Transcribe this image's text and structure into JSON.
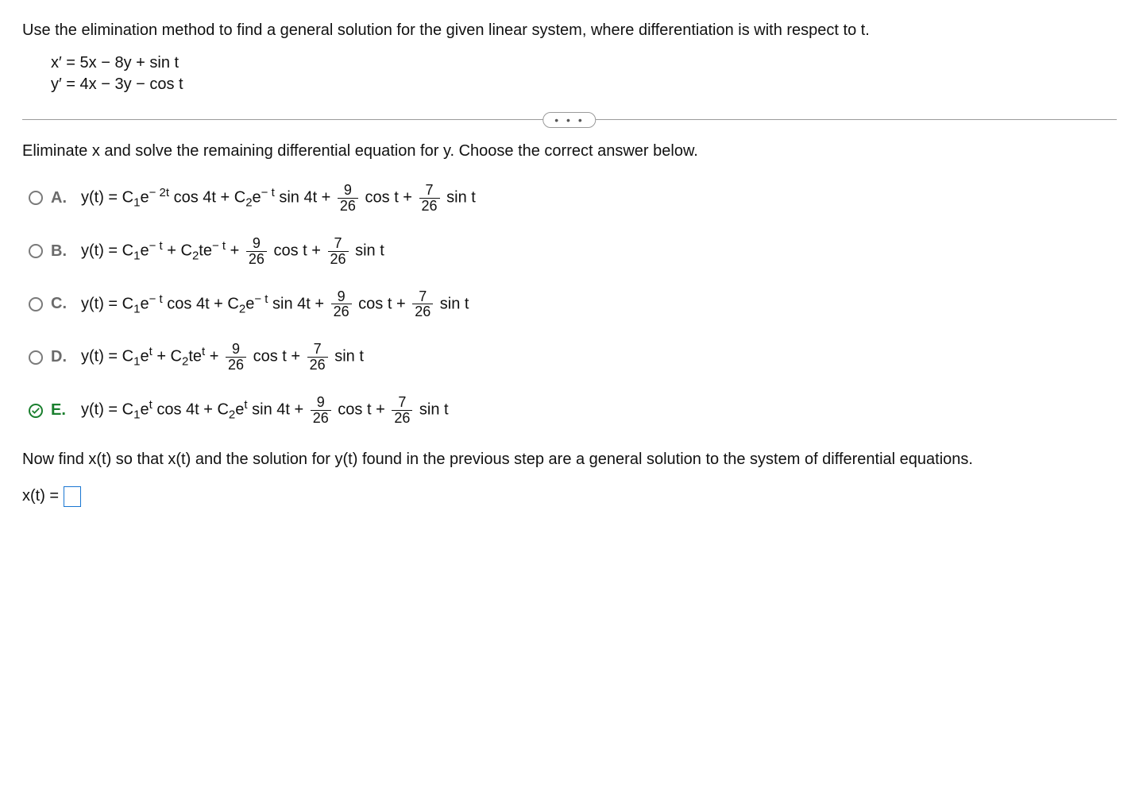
{
  "question": "Use the elimination method to find a general solution for the given linear system, where differentiation is with respect to t.",
  "system": {
    "eq1": "x′ = 5x − 8y +  sin t",
    "eq2": "y′ = 4x − 3y −  cos t"
  },
  "dots": "• • •",
  "prompt2": "Eliminate x and solve the remaining differential equation for y. Choose the correct answer below.",
  "choices": {
    "A": {
      "label": "A.",
      "pre": "y(t) = C",
      "sub1": "1",
      "exp1": "− 2t",
      "mid1": " cos 4t + C",
      "sub2": "2",
      "exp2": "− t",
      "mid2": " sin 4t + ",
      "f1n": "9",
      "f1d": "26",
      "mid3": " cos t + ",
      "f2n": "7",
      "f2d": "26",
      "tail": " sin t"
    },
    "B": {
      "label": "B.",
      "pre": "y(t) = C",
      "sub1": "1",
      "exp1": "− t",
      "mid1": " + C",
      "sub2": "2",
      "texp": "− t",
      "mid2": " + ",
      "f1n": "9",
      "f1d": "26",
      "mid3": " cos t + ",
      "f2n": "7",
      "f2d": "26",
      "tail": " sin t"
    },
    "C": {
      "label": "C.",
      "pre": "y(t) = C",
      "sub1": "1",
      "exp1": "− t",
      "mid1": " cos 4t + C",
      "sub2": "2",
      "exp2": "− t",
      "mid2": " sin 4t + ",
      "f1n": "9",
      "f1d": "26",
      "mid3": " cos t + ",
      "f2n": "7",
      "f2d": "26",
      "tail": " sin t"
    },
    "D": {
      "label": "D.",
      "pre": "y(t) = C",
      "sub1": "1",
      "exp1": "t",
      "mid1": " + C",
      "sub2": "2",
      "texp": "t",
      "mid2": " + ",
      "f1n": "9",
      "f1d": "26",
      "mid3": " cos t + ",
      "f2n": "7",
      "f2d": "26",
      "tail": " sin t"
    },
    "E": {
      "label": "E.",
      "pre": "y(t) = C",
      "sub1": "1",
      "exp1": "t",
      "mid1": " cos 4t + C",
      "sub2": "2",
      "exp2": "t",
      "mid2": " sin 4t + ",
      "f1n": "9",
      "f1d": "26",
      "mid3": " cos t + ",
      "f2n": "7",
      "f2d": "26",
      "tail": " sin t"
    }
  },
  "selected": "E",
  "post": "Now find x(t) so that x(t) and the solution for y(t) found in the previous step are a general solution to the system of differential equations.",
  "answer_label": "x(t) ="
}
